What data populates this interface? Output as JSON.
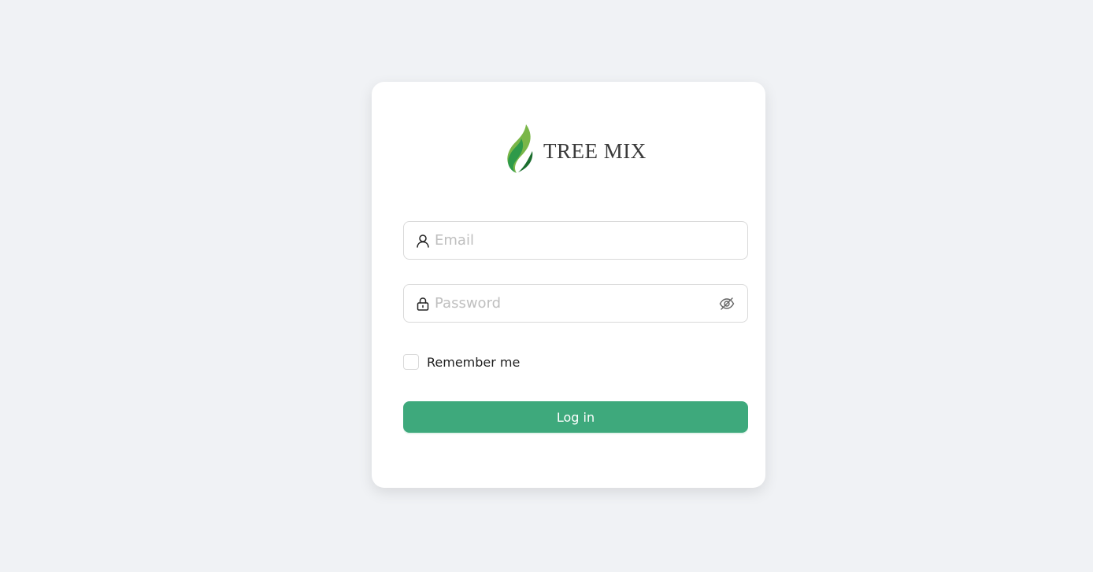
{
  "brand": {
    "name": "TREE MIX",
    "logo_icon": "flame-leaf-icon",
    "colors": [
      "#7ab648",
      "#2e9a4a",
      "#1b6e2e"
    ]
  },
  "form": {
    "email": {
      "placeholder": "Email",
      "value": "",
      "icon": "user-icon"
    },
    "password": {
      "placeholder": "Password",
      "value": "",
      "icon": "lock-icon",
      "toggle_icon": "eye-invisible-icon"
    },
    "remember_me": {
      "label": "Remember me",
      "checked": false
    },
    "submit_label": "Log in"
  },
  "theme": {
    "accent": "#3ea97c",
    "background": "#f0f2f5",
    "card": "#ffffff"
  }
}
